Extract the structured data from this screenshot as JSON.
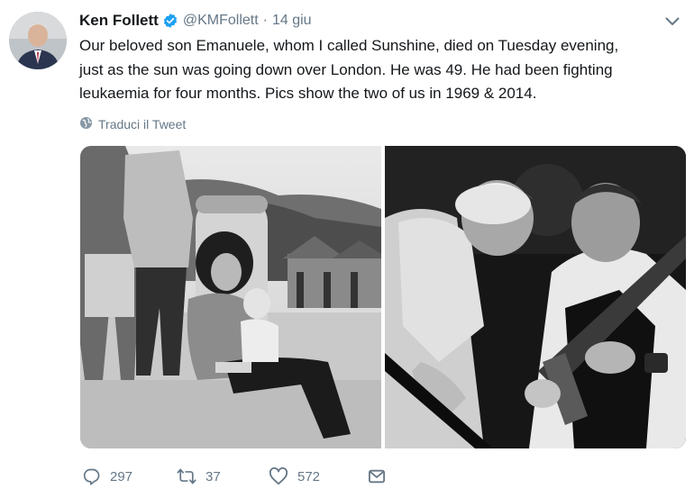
{
  "author": {
    "name": "Ken Follett",
    "handle": "@KMFollett",
    "separator": "·",
    "time": "14 giu"
  },
  "tweet": {
    "lines": [
      "Our beloved son Emanuele, whom I called Sunshine, died on Tuesday evening,",
      "just as the sun was going down over London. He was 49. He had been fighting",
      "leukaemia for four months. Pics show the two of us in 1969 & 2014."
    ]
  },
  "translate_label": "Traduci il Tweet",
  "actions": {
    "replies": "297",
    "retweets": "37",
    "likes": "572"
  },
  "icons": {
    "verified": "verified-badge-icon",
    "caret": "chevron-down-icon",
    "globe": "globe-icon",
    "reply": "reply-icon",
    "retweet": "retweet-icon",
    "like": "heart-icon",
    "dm": "envelope-icon"
  },
  "colors": {
    "text": "#14171a",
    "muted": "#657786",
    "verified": "#1da1f2"
  }
}
